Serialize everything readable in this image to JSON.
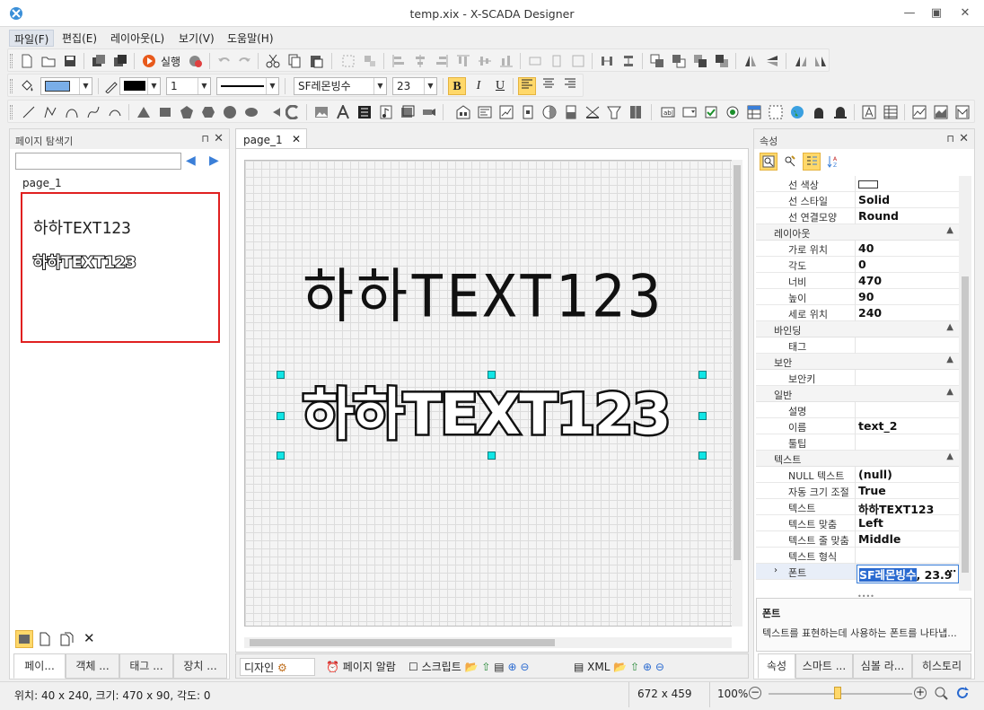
{
  "window": {
    "title": "temp.xix - X-SCADA Designer"
  },
  "menu": {
    "items": [
      "파일(F)",
      "편집(E)",
      "레이아웃(L)",
      "보기(V)",
      "도움말(H)"
    ]
  },
  "toolbar": {
    "run_label": "실행",
    "line_width": "1",
    "font_name": "SF레몬빙수",
    "font_size": "23",
    "bold": "B",
    "italic": "I",
    "underline": "U"
  },
  "left_panel": {
    "title": "페이지 탐색기",
    "page_name": "page_1",
    "thumb_line1": "하하TEXT123",
    "thumb_line2": "하하TEXT123",
    "tabs": [
      "페이...",
      "객체 ...",
      "태그 ...",
      "장치 ..."
    ]
  },
  "document": {
    "tab_label": "page_1",
    "text1": "하하TEXT123",
    "text2": "하하TEXT123",
    "bottom_tabs": [
      "디자인",
      "페이지 알람",
      "스크립트",
      "XML"
    ]
  },
  "properties": {
    "title": "속성",
    "rows": [
      {
        "type": "prop",
        "key": "선 색상",
        "value": ""
      },
      {
        "type": "prop",
        "key": "선 스타일",
        "value": "Solid"
      },
      {
        "type": "prop",
        "key": "선 연결모양",
        "value": "Round"
      },
      {
        "type": "cat",
        "key": "레이아웃"
      },
      {
        "type": "prop",
        "key": "가로 위치",
        "value": "40"
      },
      {
        "type": "prop",
        "key": "각도",
        "value": "0"
      },
      {
        "type": "prop",
        "key": "너비",
        "value": "470"
      },
      {
        "type": "prop",
        "key": "높이",
        "value": "90"
      },
      {
        "type": "prop",
        "key": "세로 위치",
        "value": "240"
      },
      {
        "type": "cat",
        "key": "바인딩"
      },
      {
        "type": "prop",
        "key": "태그",
        "value": ""
      },
      {
        "type": "cat",
        "key": "보안"
      },
      {
        "type": "prop",
        "key": "보안키",
        "value": ""
      },
      {
        "type": "cat",
        "key": "일반"
      },
      {
        "type": "prop",
        "key": "설명",
        "value": ""
      },
      {
        "type": "prop",
        "key": "이름",
        "value": "text_2"
      },
      {
        "type": "prop",
        "key": "툴팁",
        "value": ""
      },
      {
        "type": "cat",
        "key": "텍스트"
      },
      {
        "type": "prop",
        "key": "NULL 텍스트",
        "value": "(null)"
      },
      {
        "type": "prop",
        "key": "자동 크기 조절",
        "value": "True"
      },
      {
        "type": "prop",
        "key": "텍스트",
        "value": "하하TEXT123"
      },
      {
        "type": "prop",
        "key": "텍스트 맞춤",
        "value": "Left"
      },
      {
        "type": "prop",
        "key": "텍스트 줄 맞춤",
        "value": "Middle"
      },
      {
        "type": "prop",
        "key": "텍스트 형식",
        "value": ""
      }
    ],
    "font_row": {
      "key": "폰트",
      "value_highlight": "SF레몬빙수",
      "value_rest": ", 23.9"
    },
    "desc_title": "폰트",
    "desc_text": "텍스트를 표현하는데 사용하는 폰트를 나타냅...",
    "tabs": [
      "속성",
      "스마트 ...",
      "심볼 라...",
      "히스토리"
    ]
  },
  "status": {
    "position": "위치: 40 x 240, 크기: 470 x 90, 각도: 0",
    "canvas_size": "672 x 459",
    "zoom": "100%"
  },
  "colors": {
    "accent": "#ffd86a",
    "selection_border": "#e02020",
    "handle": "#11e6e6"
  }
}
